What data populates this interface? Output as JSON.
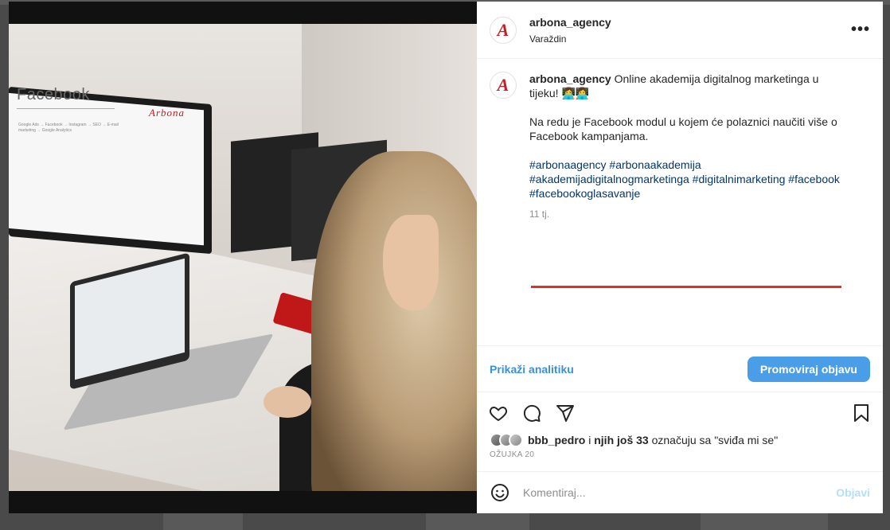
{
  "post": {
    "username": "arbona_agency",
    "location": "Varaždin",
    "more_label": "•••",
    "avatar_letter": "A"
  },
  "caption": {
    "username": "arbona_agency",
    "text": "Online akademija digitalnog marketinga u tijeku! 👩‍💻👩‍💻",
    "paragraph": "Na redu je Facebook modul u kojem će polaznici naučiti više o Facebook kampanjama.",
    "hashtags": "#arbonaagency #arbonaakademija #akademijadigitalnogmarketinga #digitalnimarketing #facebook #facebookoglasavanje",
    "time": "11 tj."
  },
  "photo": {
    "screen_title": "Facebook",
    "screen_subtitle": "Google Ads → Facebook → Instagram → SEO → E-mail marketing → Google Analytics",
    "screen_logo": "Arbona"
  },
  "promo": {
    "analytics_label": "Prikaži analitiku",
    "promote_label": "Promoviraj objavu"
  },
  "likes": {
    "user": "bbb_pedro",
    "connector": " i ",
    "others": "njih još 33",
    "suffix": " označuju sa \"sviđa mi se\"",
    "date": "OŽUJKA 20"
  },
  "comment": {
    "placeholder": "Komentiraj...",
    "post_label": "Objavi"
  },
  "colors": {
    "accent_blue": "#4a9ee8",
    "link_blue": "#3a8fdc",
    "hashtag": "#00376b",
    "brand_red": "#c41e2a"
  },
  "icons": [
    "heart-icon",
    "comment-icon",
    "share-icon",
    "bookmark-icon",
    "emoji-icon"
  ]
}
